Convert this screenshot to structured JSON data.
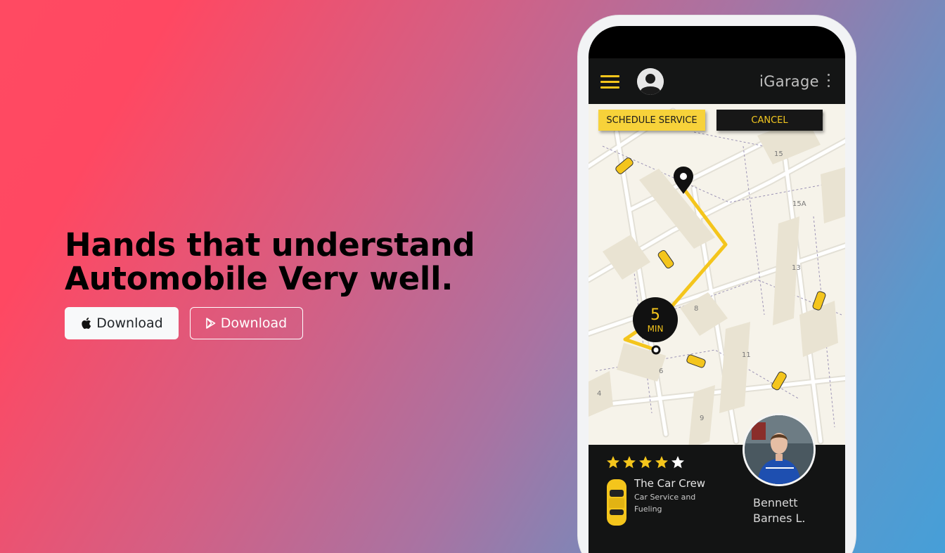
{
  "hero": {
    "headline_line1": "Hands that understand",
    "headline_line2": "Automobile Very well.",
    "apple_button_label": "Download",
    "play_button_label": "Download"
  },
  "phone": {
    "app_title": "iGarage",
    "schedule_button": "SCHEDULE SERVICE",
    "cancel_button": "CANCEL",
    "eta_value": "5",
    "eta_unit": "MIN",
    "map_labels": [
      "15",
      "15A",
      "13",
      "8",
      "11",
      "6",
      "4",
      "9"
    ],
    "rating": {
      "filled": 4,
      "total": 5
    },
    "crew_name": "The Car Crew",
    "crew_description": "Car Service and Fueling",
    "mechanic_first_name": "Bennett",
    "mechanic_last_name": "Barnes L."
  },
  "colors": {
    "accent_yellow": "#f4c51c",
    "app_dark": "#141515",
    "gradient_start": "#ff4862",
    "gradient_end": "#469fd8"
  },
  "icons": [
    "apple-icon",
    "play-store-icon",
    "hamburger-icon",
    "avatar-icon",
    "kebab-menu-icon",
    "location-pin-icon",
    "star-icon",
    "car-icon"
  ]
}
